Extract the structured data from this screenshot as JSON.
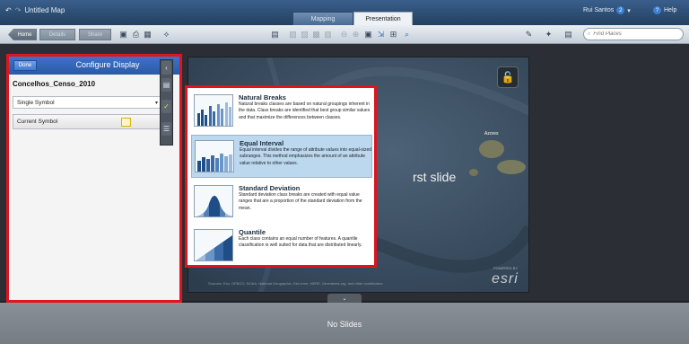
{
  "titlebar": {
    "app_title": "Untitled Map",
    "tabs": [
      "Mapping",
      "Presentation"
    ],
    "user_name": "Rui Santos",
    "help_label": "Help"
  },
  "toolbar": {
    "home_label": "Home",
    "details_label": "Details",
    "share_label": "Share",
    "search_placeholder": "Find Places"
  },
  "config_panel": {
    "done_label": "Done",
    "title": "Configure Display",
    "layer_name": "Concelhos_Censo_2010",
    "symbol_type": "Single Symbol",
    "current_symbol_label": "Current Symbol",
    "swatch_color": "#fff6c8"
  },
  "map": {
    "slide_hint": "rst slide",
    "logo": "esri",
    "powered_by": "POWERED BY",
    "credits": "Sources: Esri, GEBCO, NOAA, National Geographic, DeLorme, HERE, Geonames.org, and other contributors",
    "place_label": "Azores"
  },
  "classification": {
    "options": [
      {
        "title": "Natural Breaks",
        "description": "Natural breaks classes are based on natural groupings inherent in the data. Class breaks are identified that best group similar values and that maximize the differences between classes."
      },
      {
        "title": "Equal Interval",
        "description": "Equal interval divides the range of attribute values into equal-sized subranges. This method emphasizes the amount of an attribute value relative to other values."
      },
      {
        "title": "Standard Deviation",
        "description": "Standard deviation class breaks are created with equal value ranges that are a proportion of the standard deviation from the mean."
      },
      {
        "title": "Quantile",
        "description": "Each class contains an equal number of features. A quantile classification is well suited for data that are distributed linearly."
      }
    ],
    "selected_index": 1,
    "accent": "#e0141c"
  },
  "slides": {
    "empty_label": "No Slides"
  }
}
